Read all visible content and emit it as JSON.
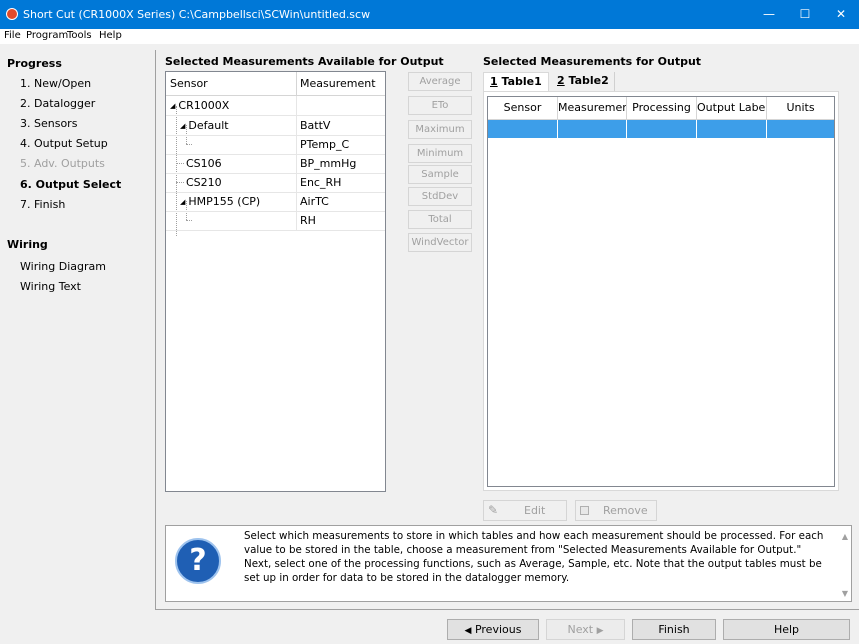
{
  "window": {
    "title": "Short Cut (CR1000X Series) C:\\Campbellsci\\SCWin\\untitled.scw",
    "controls": {
      "minimize": "—",
      "maximize": "☐",
      "close": "✕"
    }
  },
  "menu": [
    "File",
    "Program",
    "Tools",
    "Help"
  ],
  "progress": {
    "heading": "Progress",
    "steps": [
      "1. New/Open",
      "2. Datalogger",
      "3. Sensors",
      "4. Output Setup",
      "5. Adv. Outputs",
      "6. Output Select",
      "7. Finish"
    ]
  },
  "wiring": {
    "heading": "Wiring",
    "items": [
      "Wiring Diagram",
      "Wiring Text"
    ]
  },
  "available": {
    "title": "Selected Measurements Available for Output",
    "col_sensor": "Sensor",
    "col_measurement": "Measurement",
    "rows": [
      {
        "sensor": "CR1000X",
        "measurement": ""
      },
      {
        "sensor": "Default",
        "measurement": "BattV"
      },
      {
        "sensor": "",
        "measurement": "PTemp_C"
      },
      {
        "sensor": "CS106",
        "measurement": "BP_mmHg"
      },
      {
        "sensor": "CS210",
        "measurement": "Enc_RH"
      },
      {
        "sensor": "HMP155 (CP)",
        "measurement": "AirTC"
      },
      {
        "sensor": "",
        "measurement": "RH"
      }
    ]
  },
  "processing_buttons": [
    "Average",
    "ETo",
    "Maximum",
    "Minimum",
    "Sample",
    "StdDev",
    "Total",
    "WindVector"
  ],
  "output": {
    "title": "Selected Measurements for Output",
    "tabs": [
      {
        "num": "1",
        "label": "Table1"
      },
      {
        "num": "2",
        "label": "Table2"
      }
    ],
    "columns": [
      "Sensor",
      "Measurement",
      "Processing",
      "Output Label",
      "Units"
    ],
    "edit_label": "Edit",
    "remove_label": "Remove"
  },
  "info": {
    "text": "Select which measurements to store in which tables and how each measurement should be processed. For each value to be stored in the table, choose a measurement from \"Selected Measurements Available for Output.\"  Next, select one of the processing functions, such as Average, Sample, etc. Note that the output tables must be set up in order for data to be stored in the datalogger memory."
  },
  "nav": {
    "previous": "Previous",
    "next": "Next",
    "finish": "Finish",
    "help": "Help"
  }
}
